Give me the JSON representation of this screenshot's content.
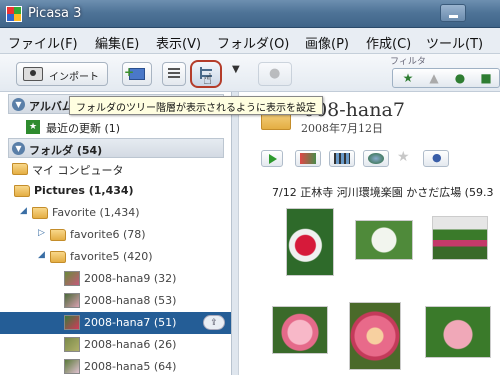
{
  "window": {
    "title": "Picasa 3"
  },
  "menu": [
    "ファイル(F)",
    "編集(E)",
    "表示(V)",
    "フォルダ(O)",
    "画像(P)",
    "作成(C)",
    "ツール(T)"
  ],
  "toolbar": {
    "import_label": "インポート",
    "filter_label": "フィルタ",
    "tooltip": "フォルダのツリー階層が表示されるように表示を設定"
  },
  "tree": {
    "albums_header": "アルバム (1)",
    "recent_updates": "最近の更新 (1)",
    "folders_header": "フォルダ (54)",
    "my_computer": "マイ コンピュータ",
    "pictures": "Pictures (1,434)",
    "favorite": "Favorite (1,434)",
    "favorite6": "favorite6 (78)",
    "favorite5": "favorite5 (420)",
    "items": [
      {
        "label": "2008-hana9 (32)"
      },
      {
        "label": "2008-hana8 (53)"
      },
      {
        "label": "2008-hana7 (51)",
        "selected": true
      },
      {
        "label": "2008-hana6 (26)"
      },
      {
        "label": "2008-hana5 (64)"
      }
    ]
  },
  "album": {
    "title": "2008-hana7",
    "title_visible": "008-hana7",
    "date": "2008年7月12日",
    "caption": "7/12 正林寺 河川環境楽園 かさだ広場 (59.3"
  },
  "colors": {
    "selection": "#245d96",
    "accent_green": "#2e8b2e"
  }
}
